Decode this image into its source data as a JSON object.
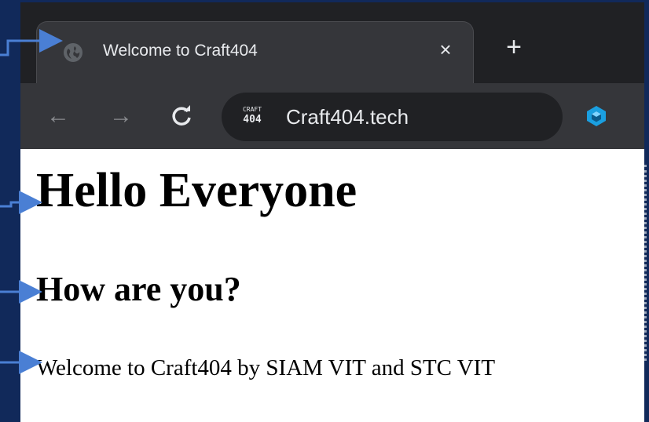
{
  "tab": {
    "title": "Welcome to Craft404",
    "close_icon": "×",
    "new_tab_icon": "+"
  },
  "toolbar": {
    "back_icon": "←",
    "forward_icon": "→",
    "reload_icon": "C",
    "site_logo_line1": "CRAFT",
    "site_logo_line2": "404",
    "url": "Craft404.tech",
    "extension_icon": "hexagon-extension-icon"
  },
  "page": {
    "heading1": "Hello Everyone",
    "heading2": "How are you?",
    "paragraph": "Welcome to Craft404 by SIAM VIT and STC VIT"
  },
  "colors": {
    "slide_background": "#11295a",
    "arrow": "#4a7fd4",
    "tab_strip": "#202124",
    "toolbar": "#35363a",
    "extension_accent": "#1a9fe0"
  }
}
